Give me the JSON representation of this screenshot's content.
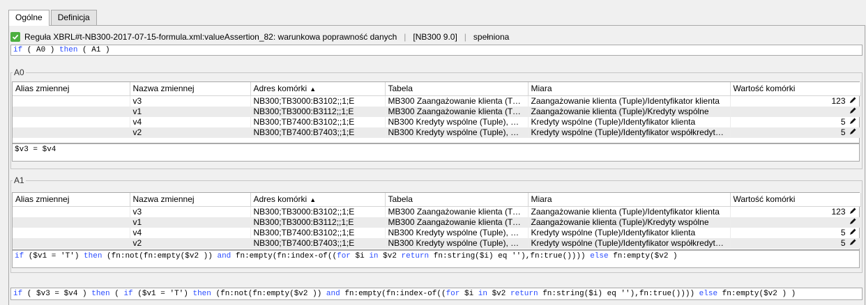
{
  "tabs": [
    {
      "label": "Ogólne",
      "active": true
    },
    {
      "label": "Definicja",
      "active": false
    }
  ],
  "rule": {
    "name": "Reguła XBRL#t-NB300-2017-07-15-formula.xml:valueAssertion_82: warunkowa poprawność danych",
    "version": "[NB300 9.0]",
    "status": "spełniona",
    "status_color": "#4caf3f"
  },
  "top_formula": {
    "kw_if": "if",
    "cond": " ( A0 ) ",
    "kw_then": "then",
    "rest": " ( A1 )"
  },
  "columns": {
    "alias": "Alias zmiennej",
    "name": "Nazwa zmiennej",
    "address": "Adres komórki",
    "table": "Tabela",
    "measure": "Miara",
    "value": "Wartość komórki"
  },
  "A0": {
    "legend": "A0",
    "rows": [
      {
        "alias": "",
        "name": "v3",
        "address": "NB300;TB3000:B3102;;1;E",
        "table": "MB300 Zaangażowanie klienta (Tuple)",
        "measure": "Zaangażowanie klienta (Tuple)/Identyfikator klienta",
        "value": "123"
      },
      {
        "alias": "",
        "name": "v1",
        "address": "NB300;TB3000:B3112;;1;E",
        "table": "MB300 Zaangażowanie klienta (Tuple)",
        "measure": "Zaangażowanie klienta (Tuple)/Kredyty wspólne",
        "value": ""
      },
      {
        "alias": "",
        "name": "v4",
        "address": "NB300;TB7400:B3102;;1;E",
        "table": "NB300 Kredyty wspólne (Tuple), MB300",
        "measure": "Kredyty wspólne (Tuple)/Identyfikator klienta",
        "value": "5"
      },
      {
        "alias": "",
        "name": "v2",
        "address": "NB300;TB7400:B7403;;1;E",
        "table": "NB300 Kredyty wspólne (Tuple), MB300",
        "measure": "Kredyty wspólne (Tuple)/Identyfikator współkredytobiorcy",
        "value": "5"
      }
    ],
    "expression": "$v3 = $v4"
  },
  "A1": {
    "legend": "A1",
    "rows": [
      {
        "alias": "",
        "name": "v3",
        "address": "NB300;TB3000:B3102;;1;E",
        "table": "MB300 Zaangażowanie klienta (Tuple)",
        "measure": "Zaangażowanie klienta (Tuple)/Identyfikator klienta",
        "value": "123"
      },
      {
        "alias": "",
        "name": "v1",
        "address": "NB300;TB3000:B3112;;1;E",
        "table": "MB300 Zaangażowanie klienta (Tuple)",
        "measure": "Zaangażowanie klienta (Tuple)/Kredyty wspólne",
        "value": ""
      },
      {
        "alias": "",
        "name": "v4",
        "address": "NB300;TB7400:B3102;;1;E",
        "table": "NB300 Kredyty wspólne (Tuple), MB300",
        "measure": "Kredyty wspólne (Tuple)/Identyfikator klienta",
        "value": "5"
      },
      {
        "alias": "",
        "name": "v2",
        "address": "NB300;TB7400:B7403;;1;E",
        "table": "NB300 Kredyty wspólne (Tuple), MB300",
        "measure": "Kredyty wspólne (Tuple)/Identyfikator współkredytobiorcy",
        "value": "5"
      }
    ],
    "expr_if": "if",
    "expr_mid": " ($v1 = 'T') ",
    "expr_then": "then",
    "expr_body": " (fn:not(fn:empty($v2 )) ",
    "expr_and": "and",
    "expr_body2": " fn:empty(fn:index-of((",
    "expr_for": "for",
    "expr_body3": " $i ",
    "expr_in": "in",
    "expr_body4": " $v2 ",
    "expr_return": "return",
    "expr_body5": " fn:string($i) eq ''),fn:true()))) ",
    "expr_else": "else",
    "expr_body6": " fn:empty($v2 )"
  },
  "bottom_formula": {
    "p1": "if",
    "p2": " ( $v3 = $v4 ) ",
    "p3": "then",
    "p4": " ( ",
    "p5": "if",
    "p6": " ($v1 = 'T') ",
    "p7": "then",
    "p8": " (fn:not(fn:empty($v2 )) ",
    "p9": "and",
    "p10": " fn:empty(fn:index-of((",
    "p11": "for",
    "p12": " $i ",
    "p13": "in",
    "p14": " $v2 ",
    "p15": "return",
    "p16": " fn:string($i) eq ''),fn:true()))) ",
    "p17": "else",
    "p18": " fn:empty($v2 ) )"
  }
}
